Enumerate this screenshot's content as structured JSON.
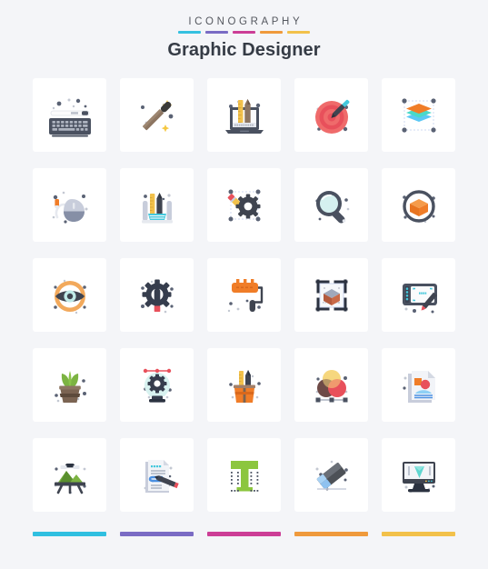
{
  "header": {
    "eyebrow": "ICONOGRAPHY",
    "title": "Graphic Designer",
    "rule_colors": [
      "#35c0e0",
      "#7a6bc4",
      "#cc3e96",
      "#ef9a3c",
      "#f2c14b"
    ]
  },
  "footer": {
    "bar_colors": [
      "#2fbfe0",
      "#7a6bc4",
      "#cc3e96",
      "#ef9a3c",
      "#f2c14b"
    ]
  },
  "palette": {
    "background": "#f4f5f8",
    "card": "#ffffff",
    "dark": "#4a5160",
    "darker": "#363d4d",
    "orange": "#f07d28",
    "red": "#e8505b",
    "green": "#8cc63f",
    "cyan": "#45c8dc",
    "blue": "#4a90e2",
    "gray": "#c9ccd4",
    "light_gray": "#e3e6ec",
    "brown": "#6b5647",
    "yellow": "#f5c842"
  },
  "icons": [
    {
      "row": 1,
      "col": 1,
      "name": "keyboard-icon",
      "label": "Keyboard"
    },
    {
      "row": 1,
      "col": 2,
      "name": "magic-wand-icon",
      "label": "Magic Wand"
    },
    {
      "row": 1,
      "col": 3,
      "name": "laptop-design-tools-icon",
      "label": "Laptop with Design Tools"
    },
    {
      "row": 1,
      "col": 4,
      "name": "target-pen-icon",
      "label": "Target with Pen"
    },
    {
      "row": 1,
      "col": 5,
      "name": "layers-icon",
      "label": "Layers"
    },
    {
      "row": 2,
      "col": 1,
      "name": "computer-mouse-icon",
      "label": "Computer Mouse"
    },
    {
      "row": 2,
      "col": 2,
      "name": "design-tools-holder-icon",
      "label": "Design Tools Holder"
    },
    {
      "row": 2,
      "col": 3,
      "name": "pencil-gear-icon",
      "label": "Pencil and Gear"
    },
    {
      "row": 2,
      "col": 4,
      "name": "magnifier-icon",
      "label": "Magnifier"
    },
    {
      "row": 2,
      "col": 5,
      "name": "cube-circle-icon",
      "label": "3D Cube in Circle"
    },
    {
      "row": 3,
      "col": 1,
      "name": "eye-icon",
      "label": "Eye"
    },
    {
      "row": 3,
      "col": 2,
      "name": "gear-pen-icon",
      "label": "Gear with Pen"
    },
    {
      "row": 3,
      "col": 3,
      "name": "paint-roller-icon",
      "label": "Paint Roller"
    },
    {
      "row": 3,
      "col": 4,
      "name": "cube-frame-icon",
      "label": "3D Cube in Frame"
    },
    {
      "row": 3,
      "col": 5,
      "name": "graphics-tablet-icon",
      "label": "Graphics Tablet"
    },
    {
      "row": 4,
      "col": 1,
      "name": "plant-pot-icon",
      "label": "Potted Plant"
    },
    {
      "row": 4,
      "col": 2,
      "name": "lightbulb-gear-icon",
      "label": "Lightbulb with Gear"
    },
    {
      "row": 4,
      "col": 3,
      "name": "pencil-cup-icon",
      "label": "Pencil Cup"
    },
    {
      "row": 4,
      "col": 4,
      "name": "color-circles-icon",
      "label": "Color Circles"
    },
    {
      "row": 4,
      "col": 5,
      "name": "document-image-icon",
      "label": "Document with Image"
    },
    {
      "row": 5,
      "col": 1,
      "name": "easel-landscape-icon",
      "label": "Easel with Landscape"
    },
    {
      "row": 5,
      "col": 2,
      "name": "document-pencil-icon",
      "label": "Document with Pencil"
    },
    {
      "row": 5,
      "col": 3,
      "name": "typography-t-icon",
      "label": "Typography Letter T"
    },
    {
      "row": 5,
      "col": 4,
      "name": "eraser-icon",
      "label": "Eraser"
    },
    {
      "row": 5,
      "col": 5,
      "name": "monitor-design-icon",
      "label": "Monitor with Design"
    }
  ]
}
